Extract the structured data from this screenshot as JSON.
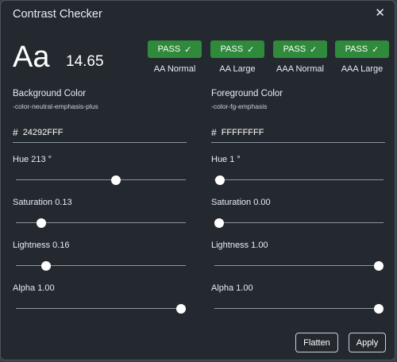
{
  "dialog": {
    "title": "Contrast Checker",
    "close_icon": "close-icon"
  },
  "preview": {
    "sample": "Aa",
    "ratio": "14.65"
  },
  "badges": [
    {
      "status": "PASS",
      "label": "AA Normal"
    },
    {
      "status": "PASS",
      "label": "AA Large"
    },
    {
      "status": "PASS",
      "label": "AAA Normal"
    },
    {
      "status": "PASS",
      "label": "AAA Large"
    }
  ],
  "background": {
    "label": "Background Color",
    "token": "-color-neutral-emphasis-plus",
    "hex": "24292FFF",
    "hue": {
      "label": "Hue 213 °",
      "value": 213,
      "max": 360
    },
    "saturation": {
      "label": "Saturation 0.13",
      "value": 0.13,
      "max": 1
    },
    "lightness": {
      "label": "Lightness 0.16",
      "value": 0.16,
      "max": 1
    },
    "alpha": {
      "label": "Alpha 1.00",
      "value": 1.0,
      "max": 1
    }
  },
  "foreground": {
    "label": "Foreground Color",
    "token": "-color-fg-emphasis",
    "hex": "FFFFFFFF",
    "hue": {
      "label": "Hue 1 °",
      "value": 1,
      "max": 360
    },
    "saturation": {
      "label": "Saturation 0.00",
      "value": 0.0,
      "max": 1
    },
    "lightness": {
      "label": "Lightness 1.00",
      "value": 1.0,
      "max": 1
    },
    "alpha": {
      "label": "Alpha 1.00",
      "value": 1.0,
      "max": 1
    }
  },
  "actions": {
    "flatten_label": "Flatten",
    "apply_label": "Apply"
  },
  "colors": {
    "pass": "#2f8a3b",
    "dialog_bg": "#24292f"
  }
}
